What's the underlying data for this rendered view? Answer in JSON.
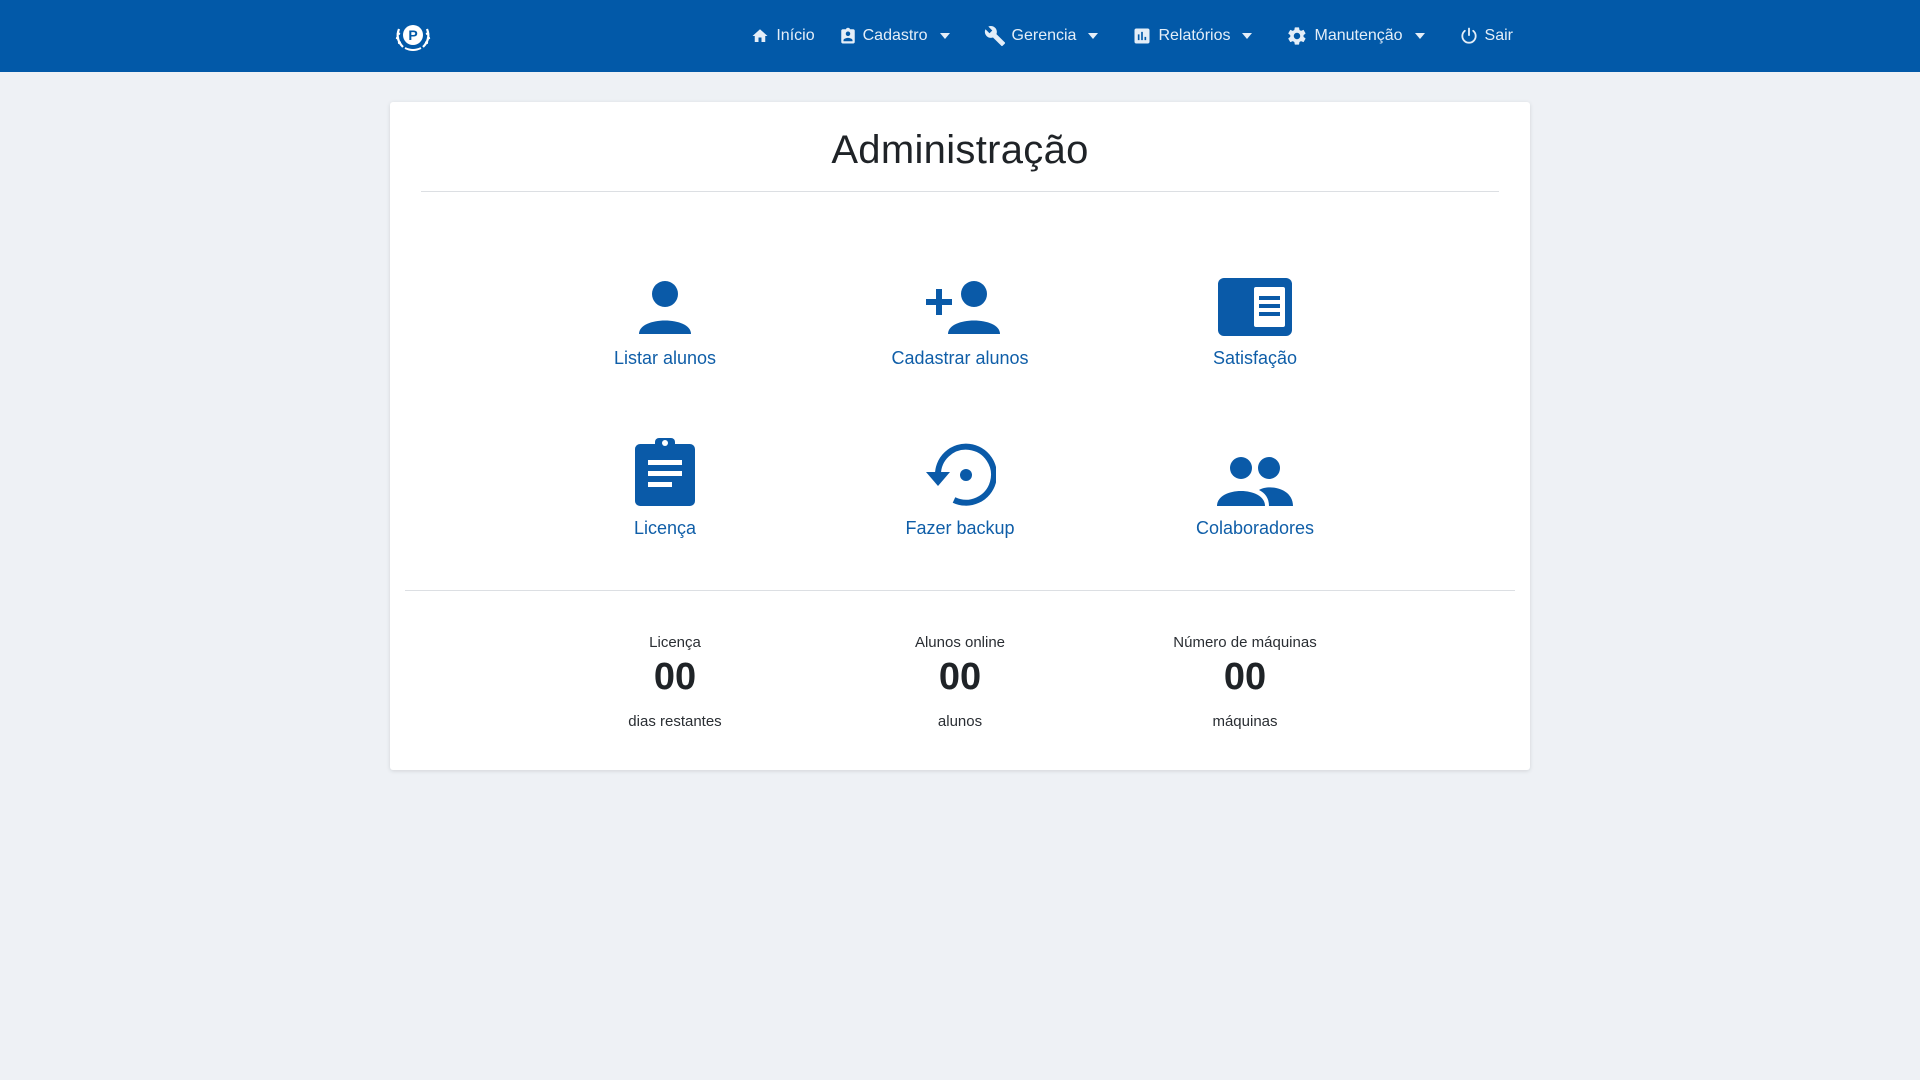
{
  "nav": {
    "items": [
      {
        "label": "Início",
        "icon": "home-icon",
        "dropdown": false
      },
      {
        "label": "Cadastro",
        "icon": "id-badge-icon",
        "dropdown": true
      },
      {
        "label": "Gerencia",
        "icon": "wrench-icon",
        "dropdown": true
      },
      {
        "label": "Relatórios",
        "icon": "bar-chart-icon",
        "dropdown": true
      },
      {
        "label": "Manutenção",
        "icon": "gear-icon",
        "dropdown": true
      },
      {
        "label": "Sair",
        "icon": "power-icon",
        "dropdown": false
      }
    ]
  },
  "page": {
    "title": "Administração"
  },
  "tiles": [
    {
      "label": "Listar alunos",
      "icon": "person-icon"
    },
    {
      "label": "Cadastrar alunos",
      "icon": "person-add-icon"
    },
    {
      "label": "Satisfação",
      "icon": "newspaper-icon"
    },
    {
      "label": "Licença",
      "icon": "clipboard-icon"
    },
    {
      "label": "Fazer backup",
      "icon": "backup-restore-icon"
    },
    {
      "label": "Colaboradores",
      "icon": "people-icon"
    }
  ],
  "stats": [
    {
      "label": "Licença",
      "value": "00",
      "unit": "dias restantes"
    },
    {
      "label": "Alunos online",
      "value": "00",
      "unit": "alunos"
    },
    {
      "label": "Número de máquinas",
      "value": "00",
      "unit": "máquinas"
    }
  ],
  "colors": {
    "navbar": "#0259a8",
    "accent": "#0a5aa8",
    "background": "#eef1f5"
  }
}
